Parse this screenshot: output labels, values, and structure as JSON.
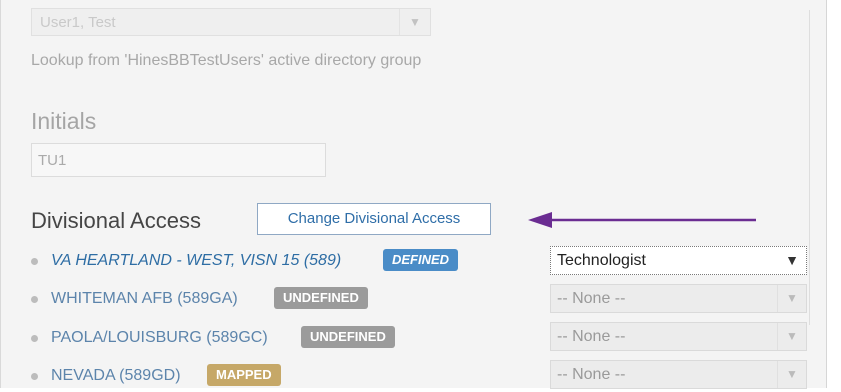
{
  "user": {
    "selected": "User1, Test",
    "lookup_hint": "Lookup from 'HinesBBTestUsers' active directory group"
  },
  "initials": {
    "label": "Initials",
    "value": "TU1"
  },
  "divisional_access": {
    "title": "Divisional Access",
    "change_button": "Change Divisional Access",
    "divisions": [
      {
        "name": "VA HEARTLAND - WEST, VISN 15 (589)",
        "status": "DEFINED",
        "role": "Technologist"
      },
      {
        "name": "WHITEMAN AFB (589GA)",
        "status": "UNDEFINED",
        "role": "-- None --"
      },
      {
        "name": "PAOLA/LOUISBURG (589GC)",
        "status": "UNDEFINED",
        "role": "-- None --"
      },
      {
        "name": "NEVADA (589GD)",
        "status": "MAPPED",
        "role": "-- None --"
      }
    ]
  },
  "colors": {
    "defined_badge": "#4a8cc7",
    "undefined_badge": "#9b9b9b",
    "mapped_badge": "#c6a868",
    "arrow": "#6a2c91",
    "link_blue": "#2e6da4"
  },
  "icons": {
    "dropdown": "chevron-down-icon",
    "arrow": "arrow-left-icon",
    "bullet": "bullet-icon"
  }
}
